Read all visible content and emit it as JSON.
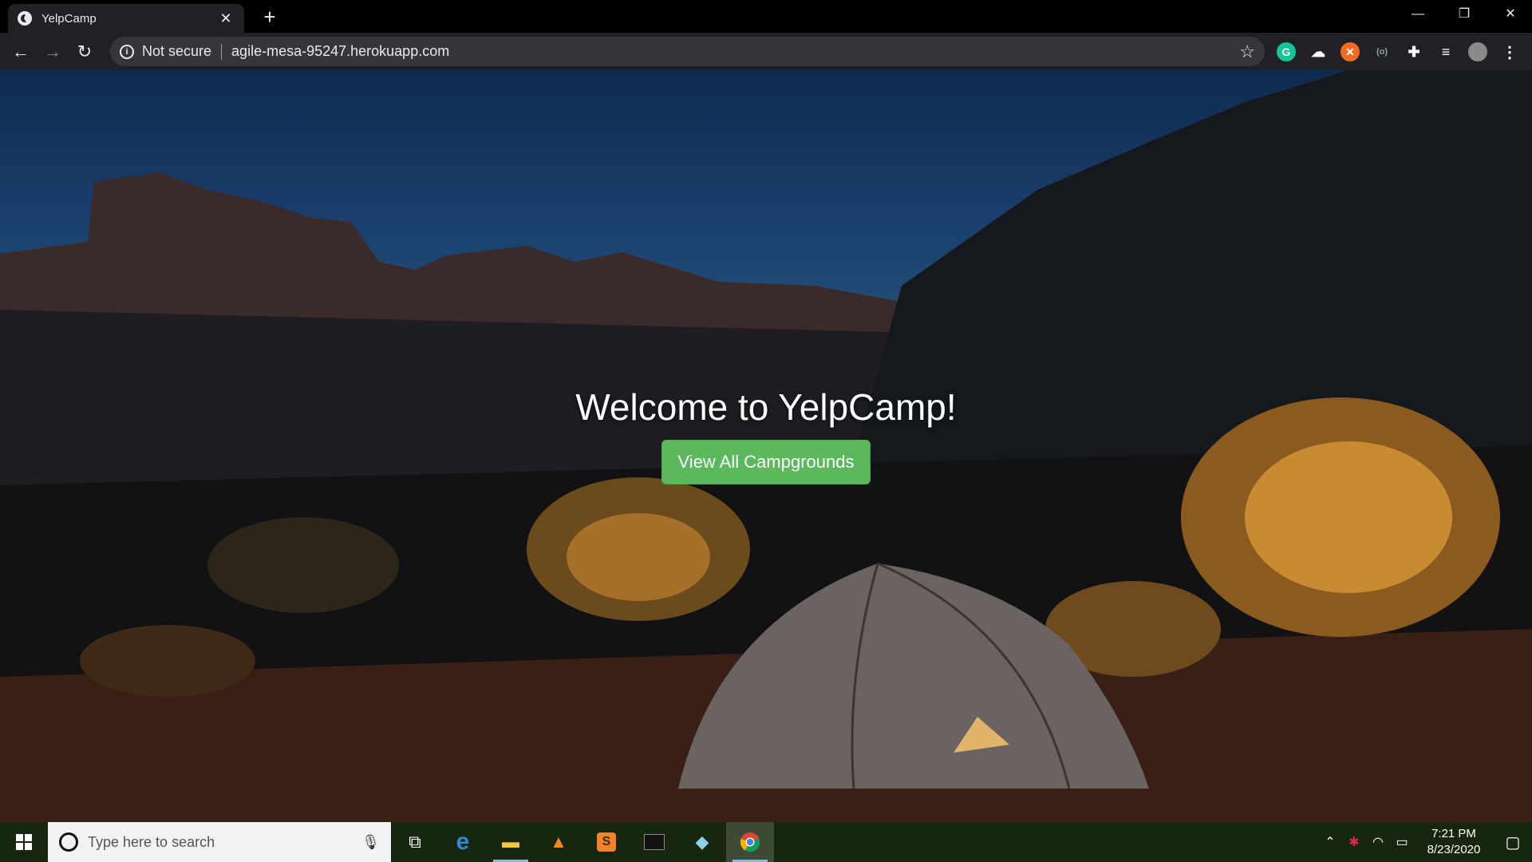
{
  "browser": {
    "tab_title": "YelpCamp",
    "security_label": "Not secure",
    "url": "agile-mesa-95247.herokuapp.com"
  },
  "window_controls": {
    "minimize": "—",
    "restore": "❐",
    "close": "✕"
  },
  "hero": {
    "heading": "Welcome to YelpCamp!",
    "button_label": "View All Campgrounds",
    "button_color": "#5cb85c"
  },
  "taskbar": {
    "search_placeholder": "Type here to search",
    "apps": [
      "task-view",
      "edge",
      "file-explorer",
      "vlc",
      "sublime-text",
      "terminal",
      "notepad",
      "chrome"
    ],
    "time": "7:21 PM",
    "date": "8/23/2020"
  },
  "colors": {
    "toolbar": "#202124",
    "omnibox": "#35363a",
    "taskbar": "#16260f"
  }
}
